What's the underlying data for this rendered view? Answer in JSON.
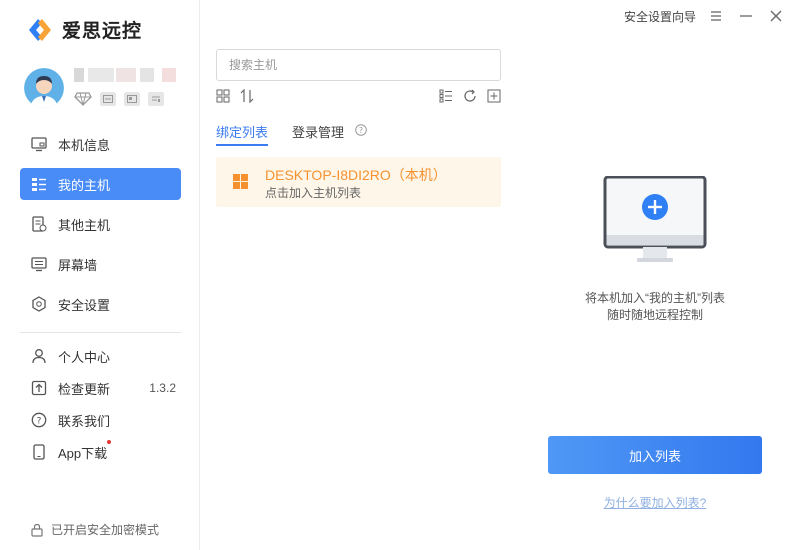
{
  "app": {
    "name": "爱思远控"
  },
  "user": {
    "badges": [
      "diamond-icon",
      "card-icon",
      "id-icon",
      "chart-icon"
    ]
  },
  "sidebar": {
    "items": [
      {
        "label": "本机信息",
        "icon": "monitor-icon"
      },
      {
        "label": "我的主机",
        "icon": "host-list-icon",
        "active": true
      },
      {
        "label": "其他主机",
        "icon": "devices-icon"
      },
      {
        "label": "屏幕墙",
        "icon": "screen-wall-icon"
      },
      {
        "label": "安全设置",
        "icon": "shield-icon"
      }
    ],
    "secondary": [
      {
        "label": "个人中心",
        "icon": "user-icon"
      },
      {
        "label": "检查更新",
        "icon": "update-icon",
        "version": "1.3.2"
      },
      {
        "label": "联系我们",
        "icon": "help-icon"
      },
      {
        "label": "App下载",
        "icon": "phone-icon",
        "dot": true
      }
    ],
    "footer": "已开启安全加密模式"
  },
  "topbar": {
    "wizard": "安全设置向导"
  },
  "search": {
    "placeholder": "搜索主机",
    "value": ""
  },
  "tabs": [
    {
      "label": "绑定列表",
      "active": true
    },
    {
      "label": "登录管理"
    }
  ],
  "host": {
    "name": "DESKTOP-I8DI2RO（本机）",
    "sub": "点击加入主机列表"
  },
  "panel": {
    "line1": "将本机加入“我的主机”列表",
    "line2": "随时随地远程控制",
    "button": "加入列表",
    "link": "为什么要加入列表?"
  },
  "colors": {
    "accent": "#4a8cf7",
    "host_highlight": "#f5922f",
    "host_bg": "#fff6ea"
  }
}
